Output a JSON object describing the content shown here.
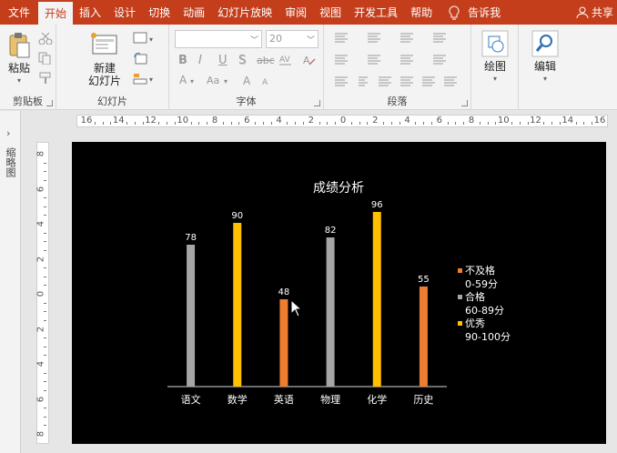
{
  "tabs": [
    {
      "label": "文件",
      "active": false
    },
    {
      "label": "开始",
      "active": true
    },
    {
      "label": "插入",
      "active": false
    },
    {
      "label": "设计",
      "active": false
    },
    {
      "label": "切换",
      "active": false
    },
    {
      "label": "动画",
      "active": false
    },
    {
      "label": "幻灯片放映",
      "active": false
    },
    {
      "label": "审阅",
      "active": false
    },
    {
      "label": "视图",
      "active": false
    },
    {
      "label": "开发工具",
      "active": false
    },
    {
      "label": "帮助",
      "active": false
    }
  ],
  "tell_me": "告诉我",
  "share": "共享",
  "ribbon": {
    "clipboard": {
      "paste": "粘贴",
      "label": "剪贴板"
    },
    "slides": {
      "new_slide_line1": "新建",
      "new_slide_line2": "幻灯片",
      "label": "幻灯片"
    },
    "font": {
      "font_size": "20",
      "label": "字体",
      "bold": "B",
      "italic": "I",
      "underline": "U",
      "shadow": "S",
      "strike": "abc"
    },
    "paragraph": {
      "label": "段落"
    },
    "drawing": {
      "label": "绘图"
    },
    "editing": {
      "label": "编辑"
    }
  },
  "left_pane": {
    "label": "缩略图"
  },
  "ruler": {
    "horizontal": [
      "16",
      "14",
      "12",
      "10",
      "8",
      "6",
      "4",
      "2",
      "0",
      "2",
      "4",
      "6",
      "8",
      "10",
      "12",
      "14",
      "16"
    ],
    "vertical": [
      "8",
      "6",
      "4",
      "2",
      "0",
      "2",
      "4",
      "6",
      "8"
    ]
  },
  "chart_data": {
    "type": "bar",
    "title": "成绩分析",
    "categories": [
      "语文",
      "数学",
      "英语",
      "物理",
      "化学",
      "历史"
    ],
    "values": [
      78,
      90,
      48,
      82,
      96,
      55
    ],
    "bar_colors": [
      "#a5a5a5",
      "#ffc000",
      "#ed7d31",
      "#a5a5a5",
      "#ffc000",
      "#ed7d31"
    ],
    "ylim": [
      0,
      100
    ],
    "grid": false,
    "legend_position": "right",
    "legend": [
      {
        "name": "不及格",
        "range": "0-59分",
        "color": "#ed7d31"
      },
      {
        "name": "合格",
        "range": "60-89分",
        "color": "#a5a5a5"
      },
      {
        "name": "优秀",
        "range": "90-100分",
        "color": "#ffc000"
      }
    ]
  }
}
